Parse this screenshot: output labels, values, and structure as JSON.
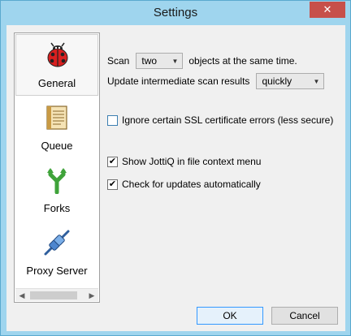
{
  "window": {
    "title": "Settings",
    "close_glyph": "✕"
  },
  "sidebar": {
    "items": [
      {
        "label": "General",
        "icon": "ladybug-icon",
        "selected": true
      },
      {
        "label": "Queue",
        "icon": "queue-list-icon",
        "selected": false
      },
      {
        "label": "Forks",
        "icon": "fork-icon",
        "selected": false
      },
      {
        "label": "Proxy Server",
        "icon": "proxy-plug-icon",
        "selected": false
      }
    ]
  },
  "general": {
    "scan_prefix": "Scan",
    "scan_value": "two",
    "scan_suffix": "objects at the same time.",
    "update_label": "Update intermediate scan results",
    "update_value": "quickly",
    "ssl_label": "Ignore certain SSL certificate errors (less secure)",
    "ssl_checked": false,
    "context_menu_label": "Show JottiQ in file context menu",
    "context_menu_checked": true,
    "updates_label": "Check for updates automatically",
    "updates_checked": true
  },
  "buttons": {
    "ok": "OK",
    "cancel": "Cancel"
  },
  "colors": {
    "frame": "#9fd5ee",
    "close": "#c7504a",
    "accent": "#3399ff"
  }
}
